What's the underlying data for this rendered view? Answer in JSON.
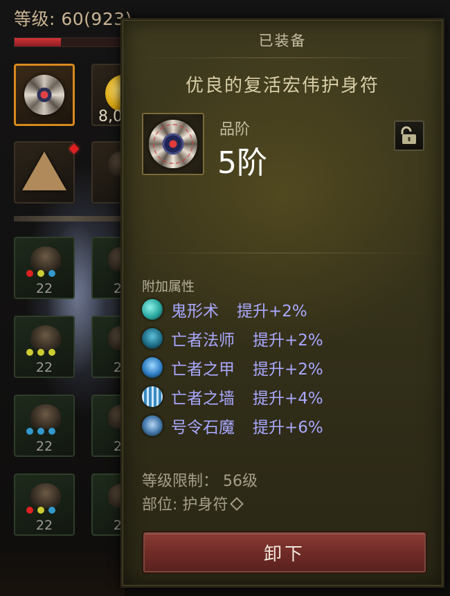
{
  "character": {
    "level_label": "等级: 60(923)",
    "xp_fill_fraction": 0.42
  },
  "slots": {
    "gold_count": "8,0",
    "gem_ranks": [
      "22",
      "22",
      "22",
      "22"
    ],
    "gem_ranks_partial": [
      "2",
      "2",
      "2",
      "2"
    ]
  },
  "tooltip": {
    "header": "已装备",
    "title": "优良的复活宏伟护身符",
    "quality_label": "品阶",
    "quality_value": "5阶",
    "lock_icon": "lock-open-icon",
    "attributes_label": "附加属性",
    "affixes": [
      {
        "name": "鬼形术",
        "bonus": "提升+2%",
        "icon": "ghost-skill-icon",
        "color": "#2aa8a0"
      },
      {
        "name": "亡者法师",
        "bonus": "提升+2%",
        "icon": "skeleton-mage-icon",
        "color": "#1f8fa8"
      },
      {
        "name": "亡者之甲",
        "bonus": "提升+2%",
        "icon": "bone-armor-icon",
        "color": "#2f7fc4"
      },
      {
        "name": "亡者之墙",
        "bonus": "提升+4%",
        "icon": "bone-wall-icon",
        "color": "#3a8ac0"
      },
      {
        "name": "号令石魔",
        "bonus": "提升+6%",
        "icon": "command-golem-icon",
        "color": "#4a7fb0"
      }
    ],
    "level_requirement": "等级限制： 56级",
    "slot_type": "部位: 护身符",
    "unequip_button": "卸下"
  },
  "colors": {
    "affix_text": "#a9a8ff",
    "selected_border": "#d88a1e",
    "unequip_button": "#8a3a34"
  }
}
